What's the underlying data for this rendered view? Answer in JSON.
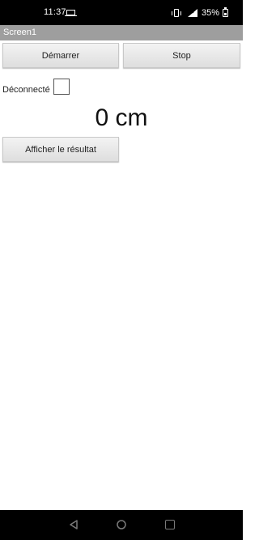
{
  "status_bar": {
    "time": "11:37",
    "battery": "35%"
  },
  "screen": {
    "title": "Screen1"
  },
  "buttons": {
    "start_label": "Démarrer",
    "stop_label": "Stop",
    "result_label": "Afficher le résultat"
  },
  "connection": {
    "label": "Déconnecté",
    "checked": false
  },
  "measurement": {
    "display": "0 cm"
  },
  "icons": {
    "status": [
      "laptop-icon",
      "vibrate-icon",
      "signal-icon",
      "battery-icon"
    ],
    "navigation": [
      "back-icon",
      "home-icon",
      "recent-apps-icon"
    ]
  },
  "colors": {
    "status_bar": "#000000",
    "title_bar": "#9e9e9e",
    "background": "#ffffff"
  }
}
